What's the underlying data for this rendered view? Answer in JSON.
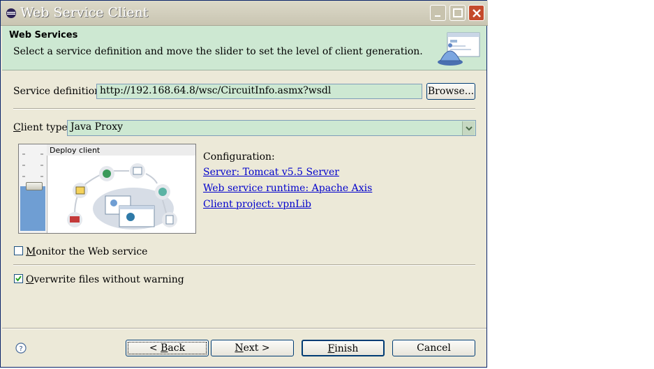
{
  "window": {
    "title": "Web Service Client"
  },
  "banner": {
    "title": "Web Services",
    "description": "Select a service definition and move the slider to set the level of client generation."
  },
  "service_definition": {
    "label": "Service definition:",
    "value": "http://192.168.64.8/wsc/CircuitInfo.asmx?wsdl",
    "browse_label": "Browse..."
  },
  "client_type": {
    "label_mnemonic": "C",
    "label_rest": "lient type:",
    "value": "Java Proxy"
  },
  "slider": {
    "level_label": "Deploy client",
    "level_fraction": 0.5
  },
  "configuration": {
    "heading": "Configuration:",
    "server": "Server: Tomcat v5.5 Server",
    "runtime": "Web service runtime: Apache Axis",
    "project": "Client project: vpnLib"
  },
  "options": {
    "monitor_mnemonic": "M",
    "monitor_rest": "onitor the Web service",
    "monitor_checked": false,
    "overwrite_mnemonic": "O",
    "overwrite_rest": "verwrite files without warning",
    "overwrite_checked": true
  },
  "buttons": {
    "back_prefix": "< ",
    "back_mnemonic": "B",
    "back_rest": "ack",
    "next_mnemonic": "N",
    "next_rest": "ext >",
    "finish_mnemonic": "F",
    "finish_rest": "inish",
    "cancel": "Cancel"
  },
  "colors": {
    "banner_bg": "#cde8d2",
    "dialog_bg": "#ece9d8",
    "link": "#0000cc"
  }
}
